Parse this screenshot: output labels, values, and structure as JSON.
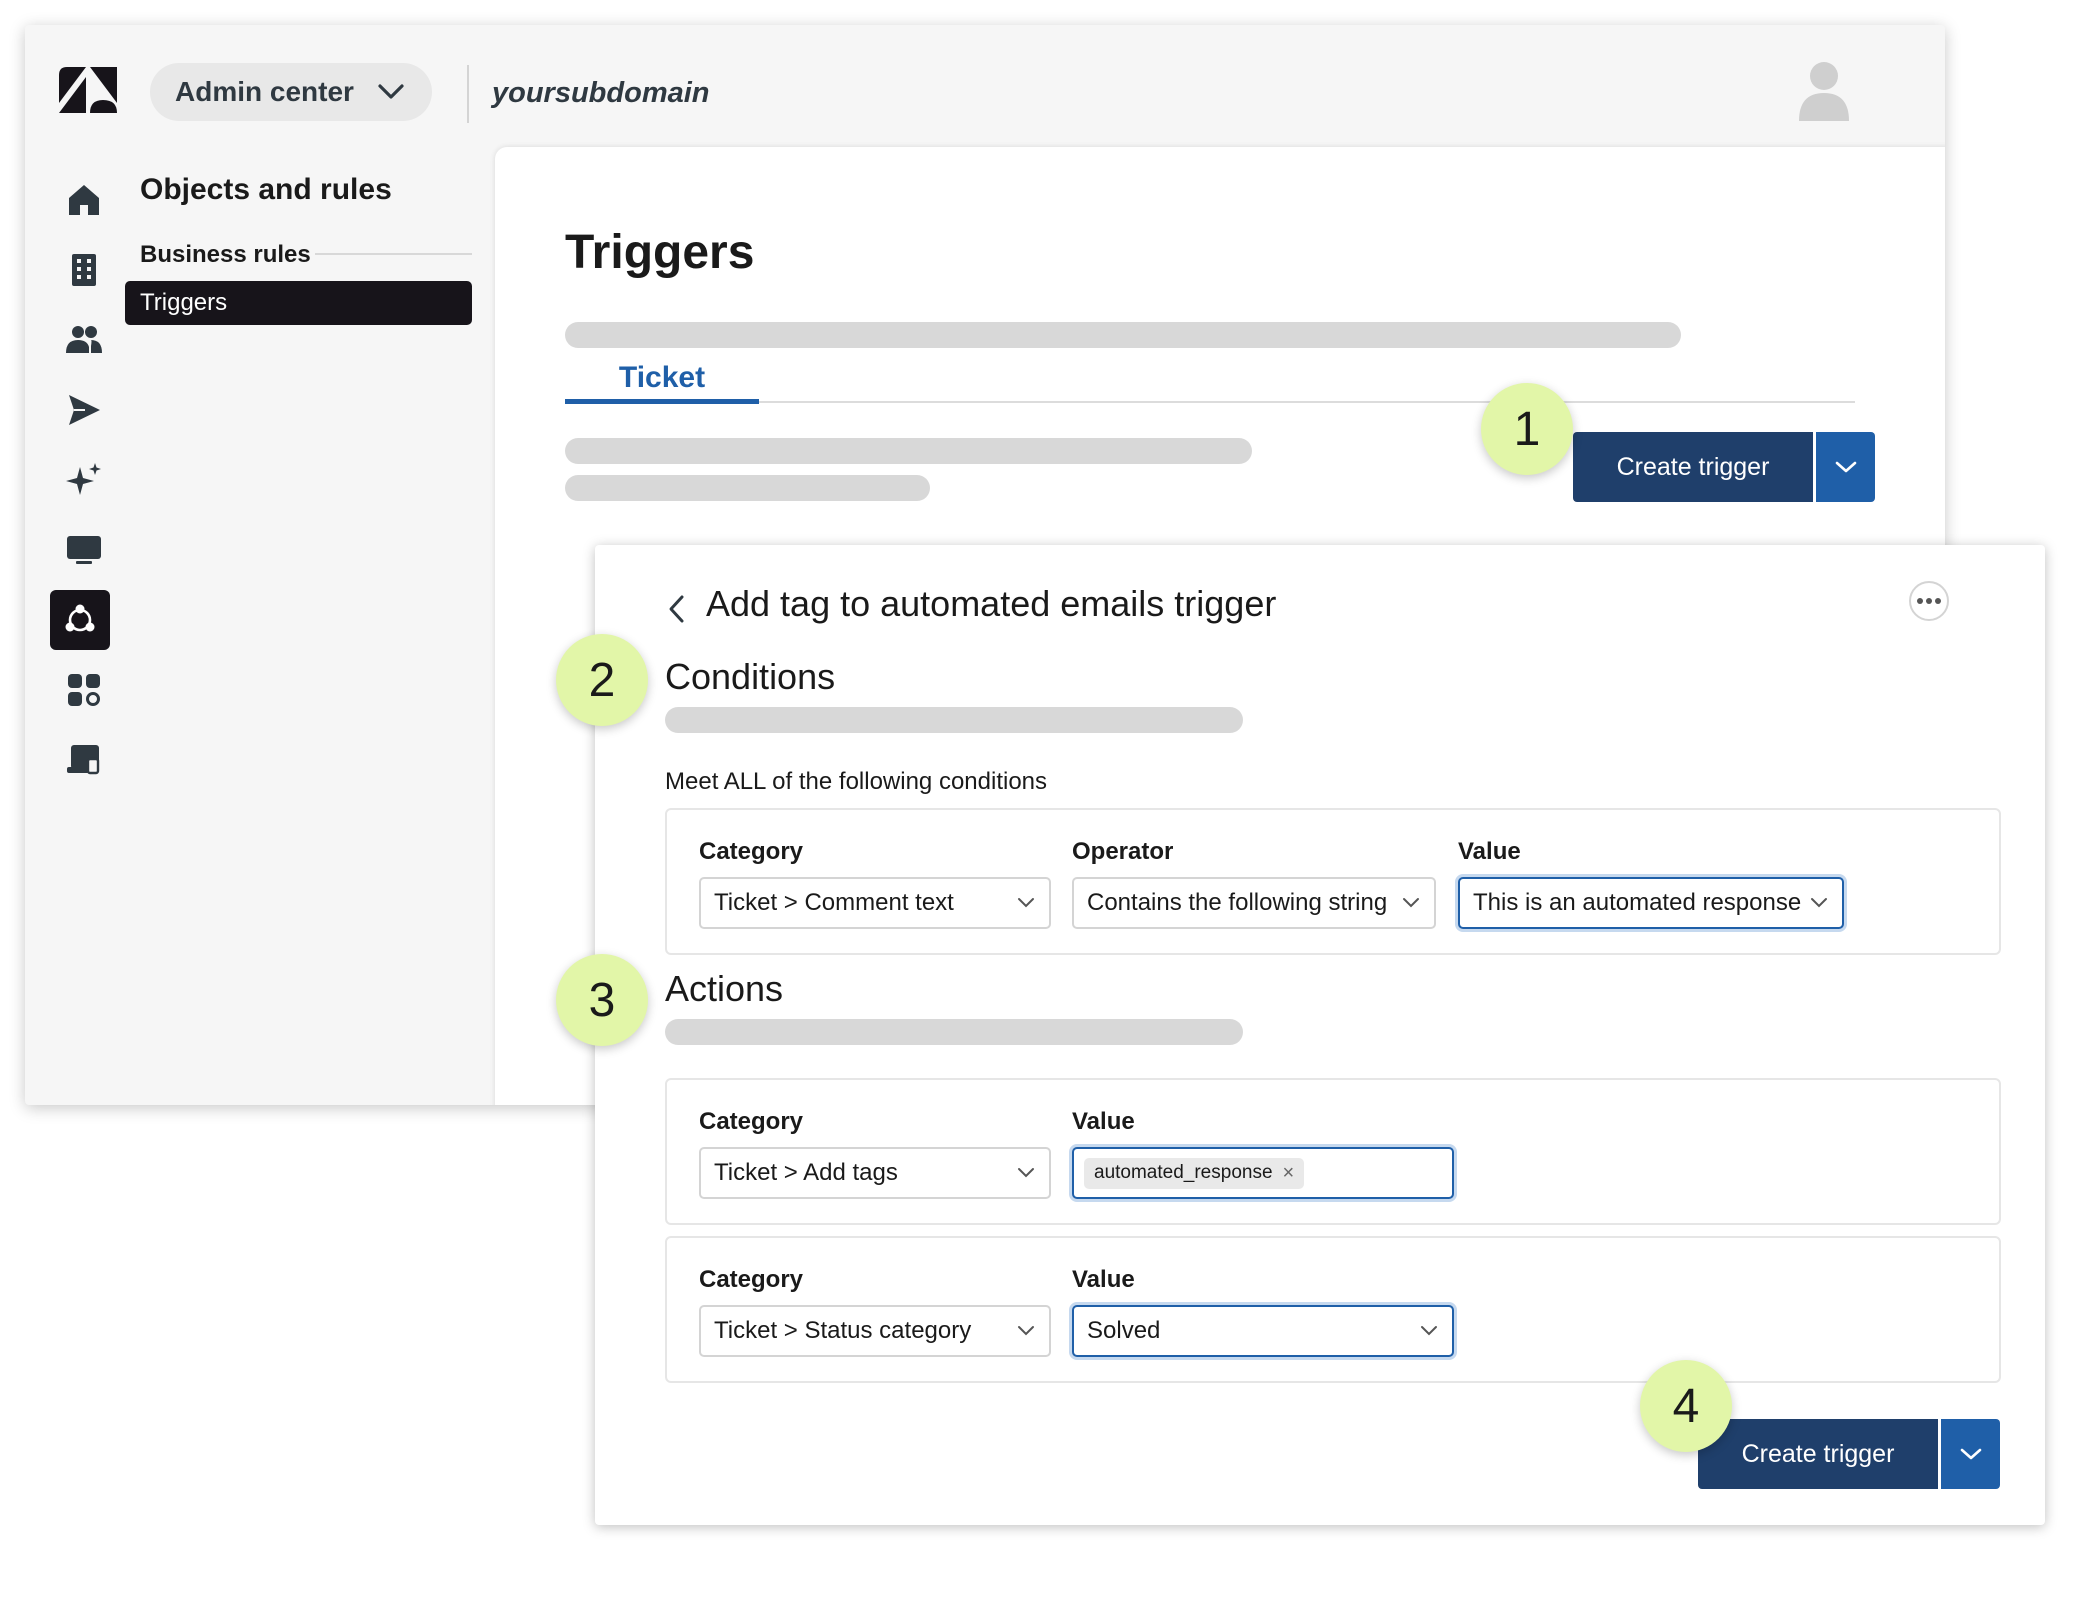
{
  "header": {
    "product_label": "Admin center",
    "subdomain": "yoursubdomain"
  },
  "sidebar": {
    "rail_icons": [
      "home-icon",
      "building-icon",
      "people-icon",
      "send-icon",
      "sparkle-icon",
      "monitor-icon",
      "objects-rules-icon",
      "apps-icon",
      "workspace-icon"
    ],
    "active_rail": "objects-rules-icon",
    "title": "Objects and rules",
    "section": "Business rules",
    "active_item": "Triggers"
  },
  "triggers_page": {
    "title": "Triggers",
    "tab": "Ticket",
    "create_button": "Create trigger"
  },
  "trigger_editor": {
    "title": "Add tag to automated emails trigger",
    "conditions": {
      "heading": "Conditions",
      "subheading": "Meet ALL of the following conditions",
      "row": {
        "category_label": "Category",
        "category_value": "Ticket > Comment text",
        "operator_label": "Operator",
        "operator_value": "Contains the following string",
        "value_label": "Value",
        "value_value": "This is an automated response"
      }
    },
    "actions": {
      "heading": "Actions",
      "rows": [
        {
          "category_label": "Category",
          "category_value": "Ticket > Add tags",
          "value_label": "Value",
          "tag": "automated_response"
        },
        {
          "category_label": "Category",
          "category_value": "Ticket > Status category",
          "value_label": "Value",
          "value_value": "Solved"
        }
      ]
    },
    "create_button": "Create trigger"
  },
  "steps": [
    "1",
    "2",
    "3",
    "4"
  ],
  "colors": {
    "brand_dark": "#17141a",
    "primary_button": "#1f3f6b",
    "split_button": "#1f5fa8",
    "link_blue": "#1f5fa8",
    "step_marker": "#e2f6a8"
  }
}
